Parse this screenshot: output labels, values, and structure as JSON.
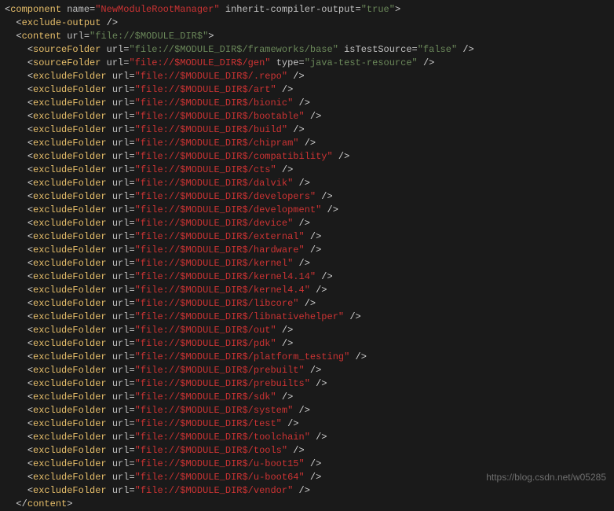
{
  "component": {
    "tag": "component",
    "nameAttr": "name",
    "nameVal": "NewModuleRootManager",
    "inheritAttr": "inherit-compiler-output",
    "inheritVal": "true"
  },
  "excludeOutput": {
    "tag": "exclude-output"
  },
  "content": {
    "tag": "content",
    "urlAttr": "url",
    "urlVal": "file://$MODULE_DIR$"
  },
  "sourceFolder1": {
    "tag": "sourceFolder",
    "urlAttr": "url",
    "urlVal": "file://$MODULE_DIR$/frameworks/base",
    "testAttr": "isTestSource",
    "testVal": "false"
  },
  "sourceFolder2": {
    "tag": "sourceFolder",
    "urlAttr": "url",
    "urlVal": "file://$MODULE_DIR$/gen",
    "typeAttr": "type",
    "typeVal": "java-test-resource"
  },
  "excludeFolders": [
    "file://$MODULE_DIR$/.repo",
    "file://$MODULE_DIR$/art",
    "file://$MODULE_DIR$/bionic",
    "file://$MODULE_DIR$/bootable",
    "file://$MODULE_DIR$/build",
    "file://$MODULE_DIR$/chipram",
    "file://$MODULE_DIR$/compatibility",
    "file://$MODULE_DIR$/cts",
    "file://$MODULE_DIR$/dalvik",
    "file://$MODULE_DIR$/developers",
    "file://$MODULE_DIR$/development",
    "file://$MODULE_DIR$/device",
    "file://$MODULE_DIR$/external",
    "file://$MODULE_DIR$/hardware",
    "file://$MODULE_DIR$/kernel",
    "file://$MODULE_DIR$/kernel4.14",
    "file://$MODULE_DIR$/kernel4.4",
    "file://$MODULE_DIR$/libcore",
    "file://$MODULE_DIR$/libnativehelper",
    "file://$MODULE_DIR$/out",
    "file://$MODULE_DIR$/pdk",
    "file://$MODULE_DIR$/platform_testing",
    "file://$MODULE_DIR$/prebuilt",
    "file://$MODULE_DIR$/prebuilts",
    "file://$MODULE_DIR$/sdk",
    "file://$MODULE_DIR$/system",
    "file://$MODULE_DIR$/test",
    "file://$MODULE_DIR$/toolchain",
    "file://$MODULE_DIR$/tools",
    "file://$MODULE_DIR$/u-boot15",
    "file://$MODULE_DIR$/u-boot64",
    "file://$MODULE_DIR$/vendor"
  ],
  "excludeFolderTag": "excludeFolder",
  "closeContent": "content",
  "watermark": "https://blog.csdn.net/w05285"
}
